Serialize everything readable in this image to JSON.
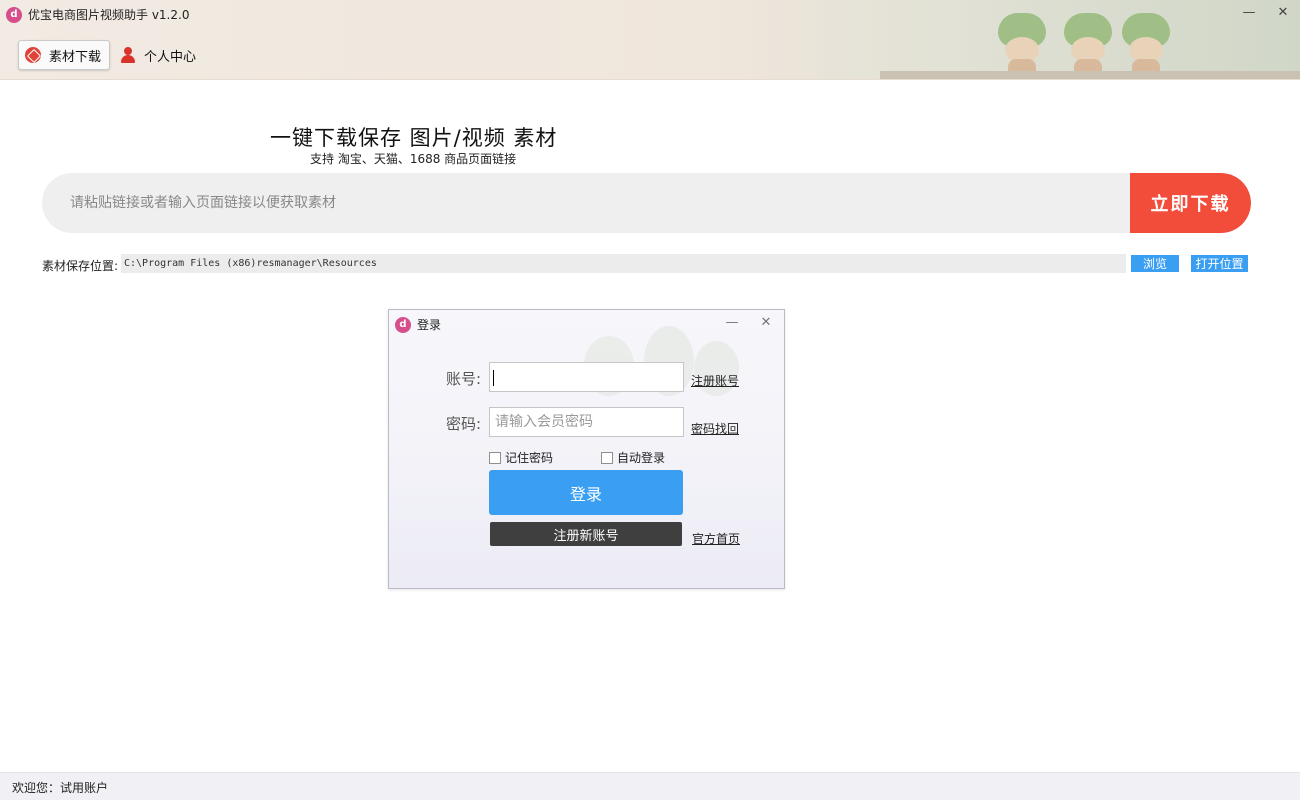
{
  "window": {
    "title": "优宝电商图片视频助手 v1.2.0",
    "minimize_glyph": "—",
    "close_glyph": "✕"
  },
  "tabs": [
    {
      "label": "素材下载",
      "icon": "cube-icon",
      "active": true
    },
    {
      "label": "个人中心",
      "icon": "person-icon",
      "active": false
    }
  ],
  "main": {
    "headline": "一键下载保存 图片/视频 素材",
    "subline": "支持 淘宝、天猫、1688 商品页面链接",
    "search_placeholder": "请粘贴链接或者输入页面链接以便获取素材",
    "download_label": "立即下载",
    "save_label": "素材保存位置:",
    "save_path": "C:\\Program Files (x86)resmanager\\Resources",
    "browse_label": "浏览",
    "open_label": "打开位置"
  },
  "login_dialog": {
    "title": "登录",
    "account_label": "账号:",
    "account_value": "",
    "password_label": "密码:",
    "password_placeholder": "请输入会员密码",
    "register_link": "注册账号",
    "recover_link": "密码找回",
    "remember_label": "记住密码",
    "remember_checked": false,
    "auto_login_label": "自动登录",
    "auto_login_checked": false,
    "login_label": "登录",
    "register_new_label": "注册新账号",
    "homepage_link": "官方首页"
  },
  "status": {
    "welcome": "欢迎您：试用账户"
  },
  "colors": {
    "accent_red": "#f24c3a",
    "accent_blue": "#3a9ff2",
    "dark_button": "#3f3f3f",
    "logo_pink": "#d64e8c"
  }
}
